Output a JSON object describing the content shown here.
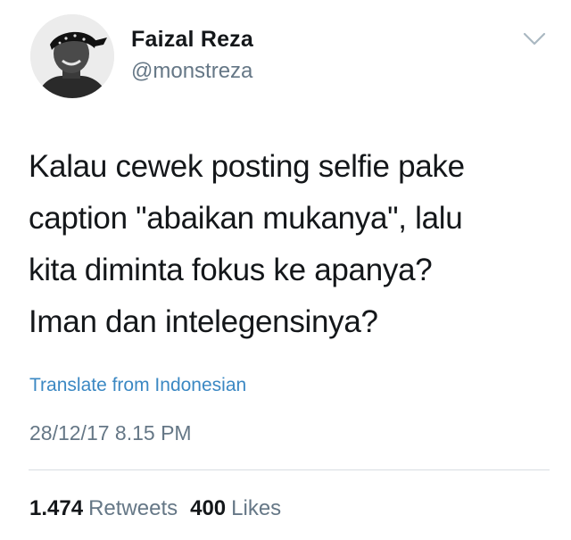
{
  "tweet": {
    "author": {
      "display_name": "Faizal Reza",
      "handle": "@monstreza",
      "avatar_icon": "profile-photo"
    },
    "menu_icon": "chevron-down-icon",
    "text": "Kalau cewek posting selfie pake\ncaption \"abaikan mukanya\", lalu\nkita diminta fokus ke apanya?\nIman dan intelegensinya?",
    "translate_label": "Translate from Indonesian",
    "timestamp": "28/12/17 8.15 PM",
    "stats": {
      "retweets_count": "1.474",
      "retweets_label": "Retweets",
      "likes_count": "400",
      "likes_label": "Likes"
    },
    "colors": {
      "text": "#14171a",
      "secondary": "#657786",
      "link": "#3b88c3",
      "divider": "#d8dde2"
    }
  }
}
